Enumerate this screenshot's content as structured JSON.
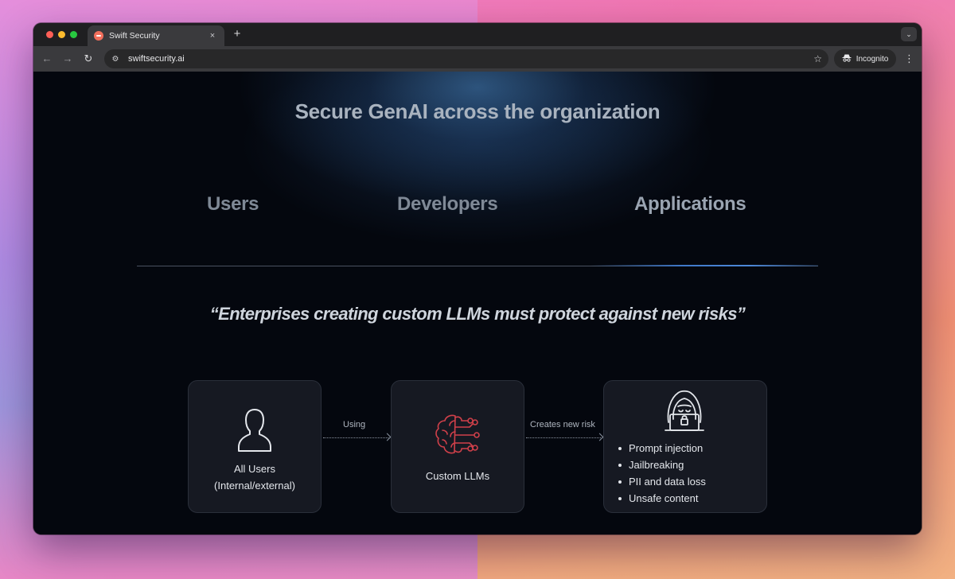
{
  "browser": {
    "tab_title": "Swift Security",
    "tab_close": "×",
    "new_tab": "+",
    "tab_menu": "⌄",
    "url": "swiftsecurity.ai",
    "incognito_label": "Incognito",
    "icons": {
      "back": "arrow-left-icon",
      "forward": "arrow-right-icon",
      "reload": "reload-icon",
      "site_info": "tune-icon",
      "bookmark": "star-icon",
      "incognito": "incognito-icon",
      "menu": "kebab-menu-icon"
    }
  },
  "page": {
    "headline": "Secure GenAI across the organization",
    "tabs": [
      {
        "label": "Users",
        "active": false
      },
      {
        "label": "Developers",
        "active": false
      },
      {
        "label": "Applications",
        "active": true
      }
    ],
    "quote": "“Enterprises creating custom LLMs must protect against new risks”",
    "diagram": {
      "users_card": {
        "line1": "All Users",
        "line2": "(Internal/external)",
        "icon": "user-silhouette-icon"
      },
      "arrow1_label": "Using",
      "llm_card": {
        "label": "Custom LLMs",
        "icon": "brain-circuit-icon"
      },
      "arrow2_label": "Creates new risk",
      "risk_card": {
        "icon": "hacker-icon",
        "items": [
          "Prompt injection",
          "Jailbreaking",
          "PII and data loss",
          "Unsafe content"
        ]
      }
    }
  },
  "colors": {
    "page_bg": "#04070e",
    "card_bg": "#161922",
    "brain_red": "#d0404a",
    "active_tab_underline": "#3f78c8"
  }
}
